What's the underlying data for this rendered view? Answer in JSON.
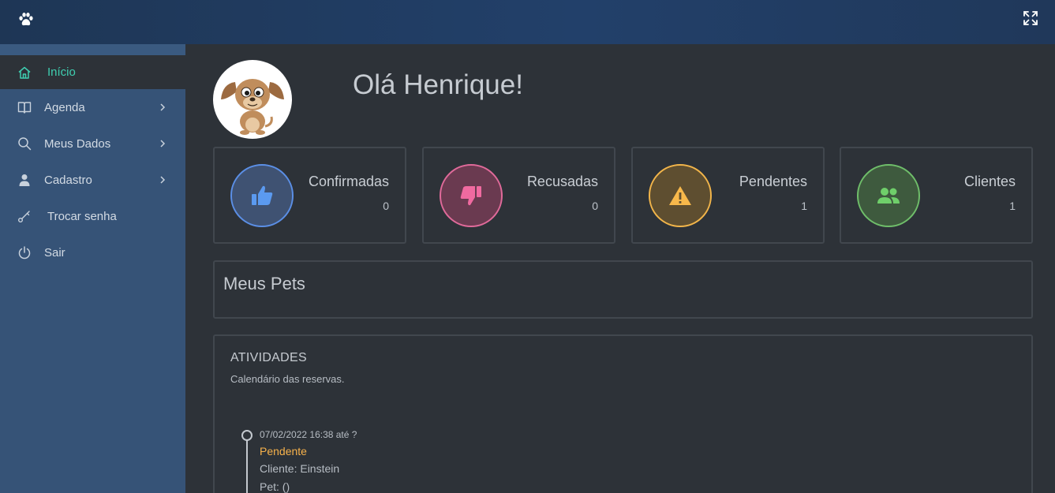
{
  "header": {
    "logo_icon": "paw-icon",
    "fullscreen_icon": "expand-icon"
  },
  "sidebar": {
    "items": [
      {
        "label": "Início",
        "icon": "home-icon",
        "active": true,
        "has_chevron": false
      },
      {
        "label": "Agenda",
        "icon": "book-icon",
        "active": false,
        "has_chevron": true
      },
      {
        "label": "Meus Dados",
        "icon": "search-icon",
        "active": false,
        "has_chevron": true
      },
      {
        "label": "Cadastro",
        "icon": "user-icon",
        "active": false,
        "has_chevron": true
      },
      {
        "label": "Trocar senha",
        "icon": "key-icon",
        "active": false,
        "has_chevron": false
      },
      {
        "label": "Sair",
        "icon": "power-icon",
        "active": false,
        "has_chevron": false
      }
    ],
    "active_color": "#3fcfb1"
  },
  "main": {
    "greeting": "Olá Henrique!",
    "cards": [
      {
        "title": "Confirmadas",
        "value": "0",
        "icon": "thumbs-up-icon",
        "color": "#5b8fe6"
      },
      {
        "title": "Recusadas",
        "value": "0",
        "icon": "thumbs-down-icon",
        "color": "#e06a9a"
      },
      {
        "title": "Pendentes",
        "value": "1",
        "icon": "warning-icon",
        "color": "#f2b54a"
      },
      {
        "title": "Clientes",
        "value": "1",
        "icon": "users-icon",
        "color": "#6fbe6a"
      }
    ],
    "pets": {
      "title": "Meus Pets"
    },
    "activities": {
      "title": "ATIVIDADES",
      "subtitle": "Calendário das reservas.",
      "events": [
        {
          "date": "07/02/2022 16:38 até ?",
          "status": "Pendente",
          "client": "Cliente: Einstein",
          "pet": "Pet: ()"
        }
      ]
    }
  }
}
